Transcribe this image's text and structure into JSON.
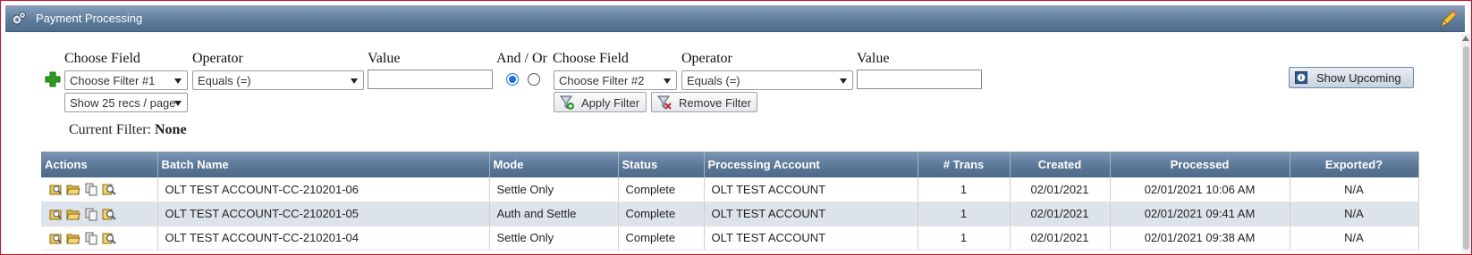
{
  "window": {
    "title": "Payment Processing"
  },
  "filter": {
    "choose_field_label": "Choose Field",
    "operator_label": "Operator",
    "value_label": "Value",
    "and_or_label": "And / Or",
    "field1_selected": "Choose Filter #1",
    "operator1_selected": "Equals (=)",
    "value1": "",
    "field2_selected": "Choose Filter #2",
    "operator2_selected": "Equals (=)",
    "value2": "",
    "page_size_selected": "Show 25 recs / page",
    "apply_label": "Apply Filter",
    "remove_label": "Remove Filter",
    "current_filter_label": "Current Filter:",
    "current_filter_value": "None",
    "and_selected": true
  },
  "show_upcoming_label": "Show Upcoming",
  "table": {
    "headers": [
      "Actions",
      "Batch Name",
      "Mode",
      "Status",
      "Processing Account",
      "# Trans",
      "Created",
      "Processed",
      "Exported?"
    ],
    "rows": [
      {
        "batch_name": "OLT TEST ACCOUNT-CC-210201-06",
        "mode": "Settle Only",
        "status": "Complete",
        "account": "OLT TEST ACCOUNT",
        "trans": "1",
        "created": "02/01/2021",
        "processed": "02/01/2021 10:06 AM",
        "exported": "N/A"
      },
      {
        "batch_name": "OLT TEST ACCOUNT-CC-210201-05",
        "mode": "Auth and Settle",
        "status": "Complete",
        "account": "OLT TEST ACCOUNT",
        "trans": "1",
        "created": "02/01/2021",
        "processed": "02/01/2021 09:41 AM",
        "exported": "N/A"
      },
      {
        "batch_name": "OLT TEST ACCOUNT-CC-210201-04",
        "mode": "Settle Only",
        "status": "Complete",
        "account": "OLT TEST ACCOUNT",
        "trans": "1",
        "created": "02/01/2021",
        "processed": "02/01/2021 09:38 AM",
        "exported": "N/A"
      }
    ]
  },
  "icons": {
    "title": "gears-icon",
    "edit": "pencil-icon",
    "add_filter": "plus-icon",
    "apply": "filter-apply-icon",
    "remove": "filter-remove-icon",
    "upcoming": "info-icon",
    "row_actions": [
      "view-icon",
      "open-folder-icon",
      "copy-icon",
      "search-icon"
    ]
  },
  "colors": {
    "header": "#5e7c9c",
    "alt_row": "#dde3ea",
    "frame_border": "#c8102e",
    "add_green": "#2a9d1e"
  }
}
